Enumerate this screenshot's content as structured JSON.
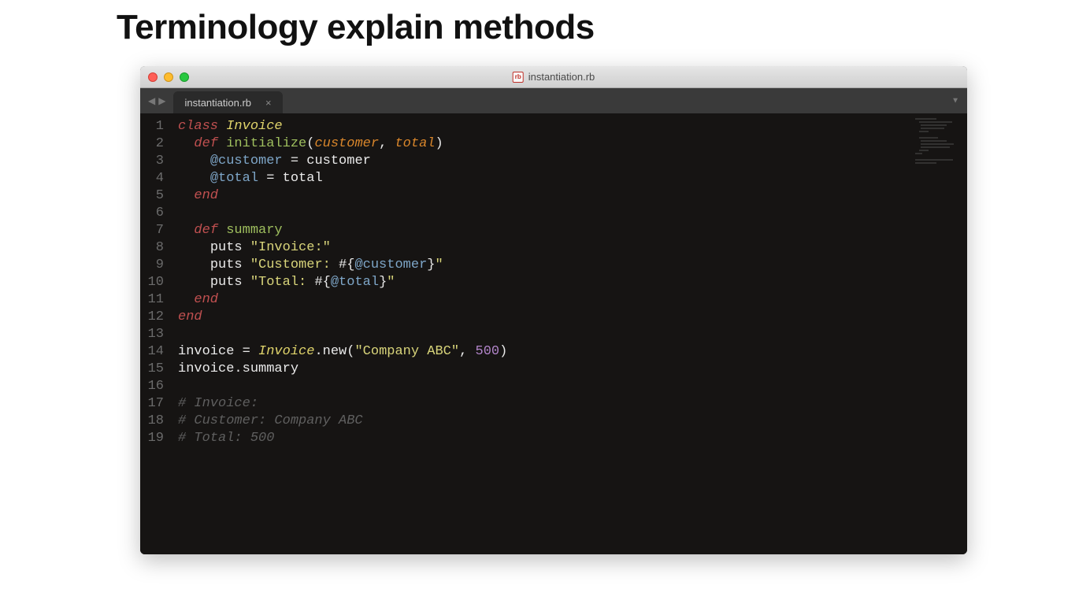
{
  "page": {
    "title": "Terminology explain methods"
  },
  "window": {
    "filename": "instantiation.rb"
  },
  "tab": {
    "label": "instantiation.rb"
  },
  "lines": {
    "l1": "1",
    "l2": "2",
    "l3": "3",
    "l4": "4",
    "l5": "5",
    "l6": "6",
    "l7": "7",
    "l8": "8",
    "l9": "9",
    "l10": "10",
    "l11": "11",
    "l12": "12",
    "l13": "13",
    "l14": "14",
    "l15": "15",
    "l16": "16",
    "l17": "17",
    "l18": "18",
    "l19": "19"
  },
  "code": {
    "r1_kw1": "class",
    "r1_cls": "Invoice",
    "r2_kw1": "def",
    "r2_mth": "initialize",
    "r2_p1": "(",
    "r2_arg1": "customer",
    "r2_c": ", ",
    "r2_arg2": "total",
    "r2_p2": ")",
    "r3_ivar": "@customer",
    "r3_eq": " = ",
    "r3_rhs": "customer",
    "r4_ivar": "@total",
    "r4_eq": " = ",
    "r4_rhs": "total",
    "r5_end": "end",
    "r7_kw1": "def",
    "r7_mth": "summary",
    "r8_puts": "puts",
    "r8_str": "\"Invoice:\"",
    "r9_puts": "puts",
    "r9_s1": "\"Customer: ",
    "r9_int": "#{",
    "r9_ivar": "@customer",
    "r9_intc": "}",
    "r9_s2": "\"",
    "r10_puts": "puts",
    "r10_s1": "\"Total: ",
    "r10_int": "#{",
    "r10_ivar": "@total",
    "r10_intc": "}",
    "r10_s2": "\"",
    "r11_end": "end",
    "r12_end": "end",
    "r14_var": "invoice",
    "r14_eq": " = ",
    "r14_cls": "Invoice",
    "r14_new": ".new(",
    "r14_str": "\"Company ABC\"",
    "r14_c": ", ",
    "r14_num": "500",
    "r14_p2": ")",
    "r15_call": "invoice.summary",
    "r17_cmt": "# Invoice:",
    "r18_cmt": "# Customer: Company ABC",
    "r19_cmt": "# Total: 500"
  }
}
